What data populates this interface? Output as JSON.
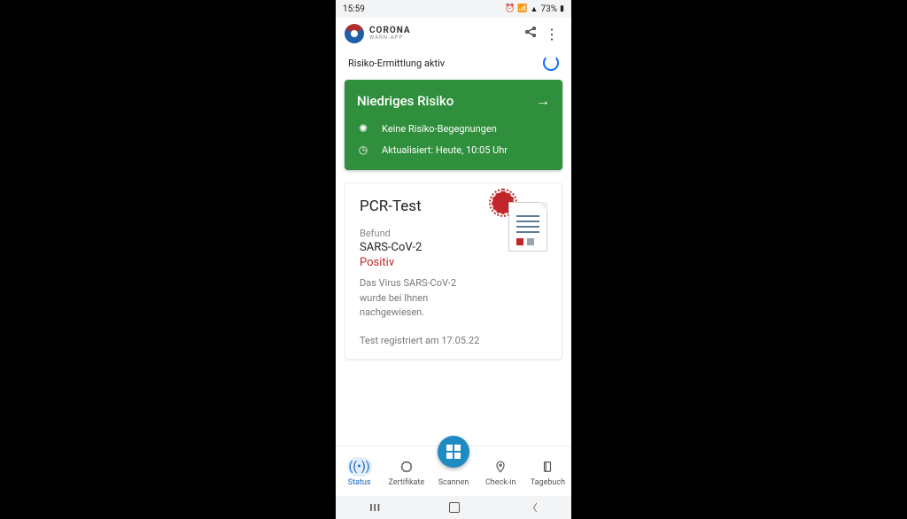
{
  "statusbar": {
    "time": "15:59",
    "battery": "73%"
  },
  "app": {
    "name_line1": "CORONA",
    "name_line2": "WARN-APP"
  },
  "risk_row": {
    "label": "Risiko-Ermittlung aktiv"
  },
  "risk_card": {
    "title": "Niedriges Risiko",
    "no_encounters": "Keine Risiko-Begegnungen",
    "updated": "Aktualisiert: Heute, 10:05 Uhr"
  },
  "pcr": {
    "title": "PCR-Test",
    "label": "Befund",
    "name": "SARS-CoV-2",
    "result": "Positiv",
    "desc": "Das Virus SARS-CoV-2 wurde bei Ihnen nachgewiesen.",
    "registered": "Test registriert am 17.05.22"
  },
  "nav": {
    "status": "Status",
    "cert": "Zertifikate",
    "scan": "Scannen",
    "checkin": "Check-in",
    "diary": "Tagebuch"
  }
}
